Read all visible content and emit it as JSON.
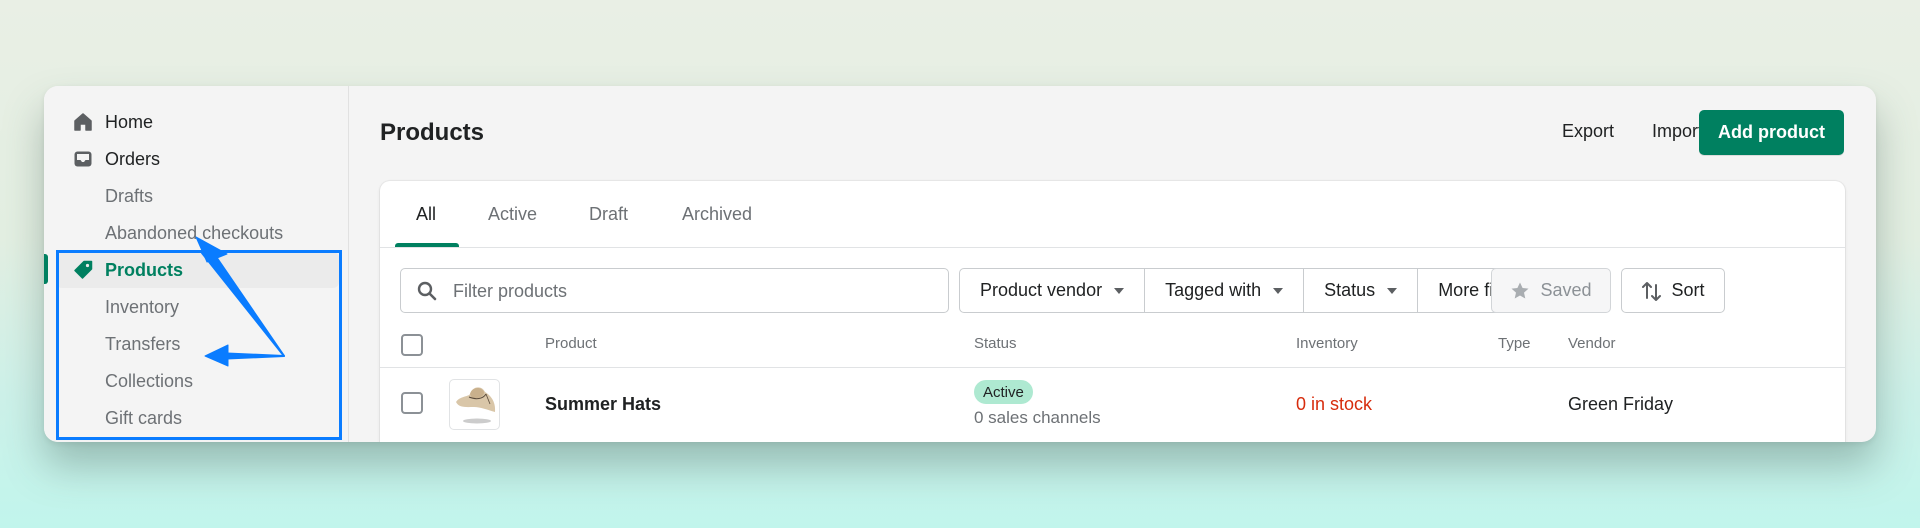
{
  "sidebar": {
    "items": [
      {
        "label": "Home",
        "icon": "home-icon"
      },
      {
        "label": "Orders",
        "icon": "inbox-icon"
      },
      {
        "label": "Drafts"
      },
      {
        "label": "Abandoned checkouts"
      },
      {
        "label": "Products",
        "icon": "tag-icon",
        "active": true
      },
      {
        "label": "Inventory"
      },
      {
        "label": "Transfers"
      },
      {
        "label": "Collections"
      },
      {
        "label": "Gift cards"
      }
    ]
  },
  "annotation": {
    "color": "#0a7cff"
  },
  "header": {
    "title": "Products",
    "export_label": "Export",
    "import_label": "Import",
    "add_label": "Add product"
  },
  "tabs": [
    {
      "label": "All",
      "active": true
    },
    {
      "label": "Active"
    },
    {
      "label": "Draft"
    },
    {
      "label": "Archived"
    }
  ],
  "filters": {
    "search_placeholder": "Filter products",
    "buttons": [
      {
        "label": "Product vendor",
        "dropdown": true
      },
      {
        "label": "Tagged with",
        "dropdown": true
      },
      {
        "label": "Status",
        "dropdown": true
      },
      {
        "label": "More filters",
        "dropdown": false
      }
    ],
    "saved_label": "Saved",
    "sort_label": "Sort"
  },
  "table": {
    "columns": [
      "Product",
      "Status",
      "Inventory",
      "Type",
      "Vendor"
    ],
    "rows": [
      {
        "product": "Summer Hats",
        "status": "Active",
        "status_sub": "0 sales channels",
        "inventory": "0 in stock",
        "type": "",
        "vendor": "Green Friday"
      }
    ]
  },
  "colors": {
    "brand": "#008060",
    "critical": "#d72c0d",
    "success_badge": "#aee9d1"
  }
}
